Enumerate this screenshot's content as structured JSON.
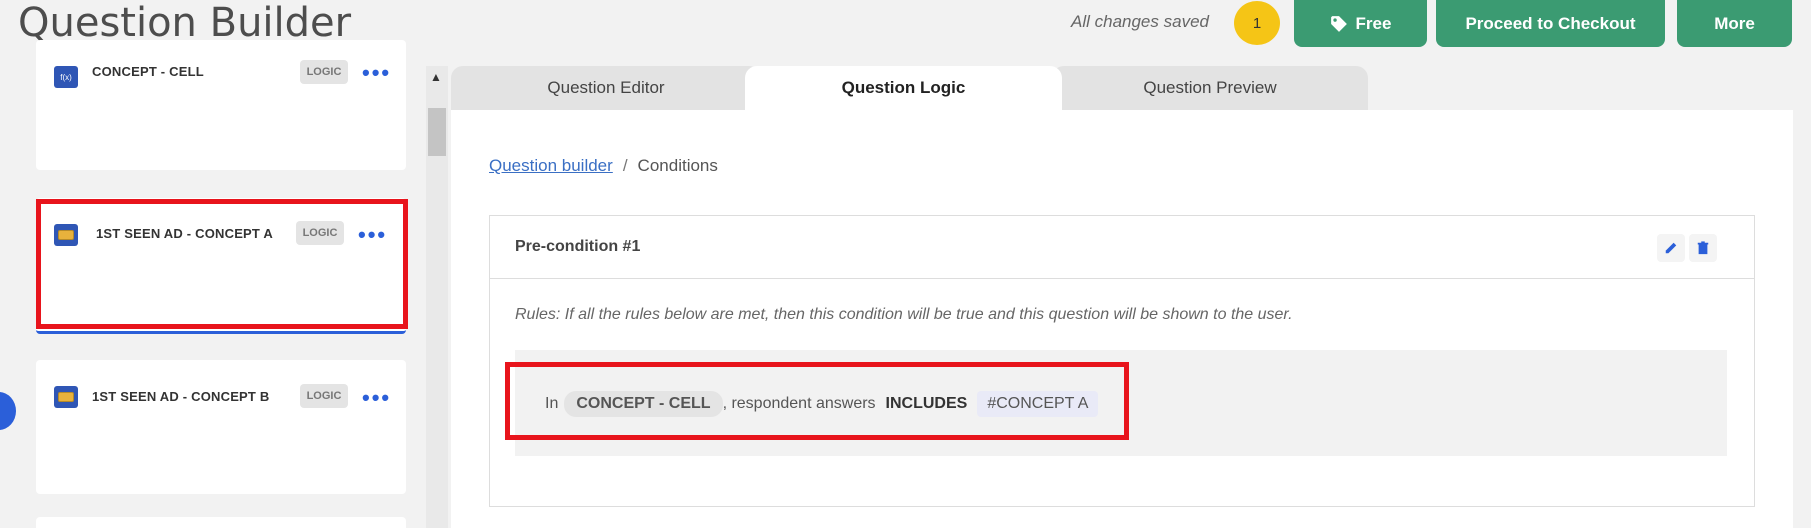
{
  "header": {
    "title": "Question Builder",
    "saved_status": "All changes saved",
    "badge_count": "1",
    "free_label": "Free",
    "checkout_label": "Proceed to Checkout",
    "more_label": "More"
  },
  "sidebar": {
    "cards": [
      {
        "title": "CONCEPT - CELL",
        "tag": "LOGIC",
        "icon": "function-icon"
      },
      {
        "title": "1ST SEEN AD - CONCEPT A",
        "tag": "LOGIC",
        "icon": "media-icon"
      },
      {
        "title": "1ST SEEN AD - CONCEPT B",
        "tag": "LOGIC",
        "icon": "media-icon"
      }
    ],
    "more_dots": "•••"
  },
  "tabs": [
    {
      "label": "Question Editor"
    },
    {
      "label": "Question Logic"
    },
    {
      "label": "Question Preview"
    }
  ],
  "breadcrumb": {
    "link": "Question builder",
    "separator": "/",
    "current": "Conditions"
  },
  "condition": {
    "title": "Pre-condition #1",
    "rules_text": "Rules: If all the rules below are met, then this condition will be true and this question will be shown to the user.",
    "rule": {
      "prefix": "In",
      "question": "CONCEPT - CELL",
      "middle": ", respondent answers",
      "operator": "INCLUDES",
      "value": "#CONCEPT A"
    }
  },
  "colors": {
    "accent_green": "#3b9b72",
    "highlight_red": "#e8141c",
    "link_blue": "#3a6fc4",
    "badge_yellow": "#f5c516"
  }
}
